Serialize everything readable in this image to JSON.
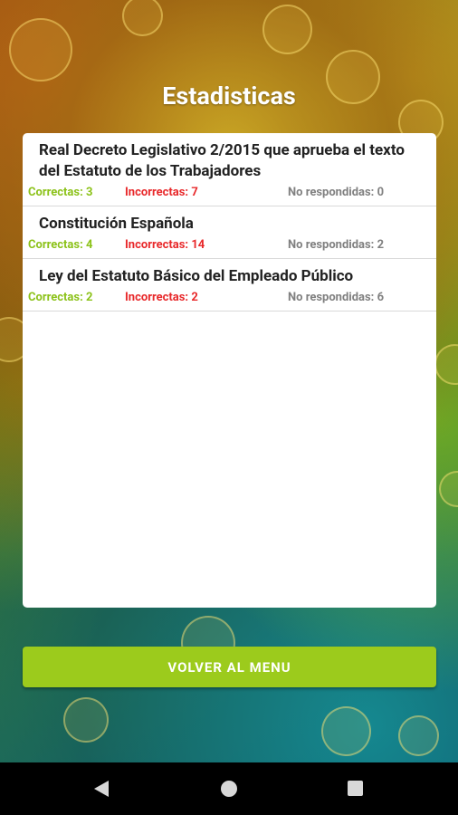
{
  "header": {
    "title": "Estadisticas"
  },
  "laws": [
    {
      "title": "Real Decreto Legislativo 2/2015 que aprueba el texto del Estatuto de los Trabajadores",
      "correct": "Correctas: 3",
      "incorrect": "Incorrectas: 7",
      "unanswered": "No respondidas: 0"
    },
    {
      "title": "Constitución Española",
      "correct": "Correctas: 4",
      "incorrect": "Incorrectas: 14",
      "unanswered": "No respondidas: 2"
    },
    {
      "title": "Ley del Estatuto Básico del Empleado Público",
      "correct": "Correctas: 2",
      "incorrect": "Incorrectas: 2",
      "unanswered": "No respondidas: 6"
    }
  ],
  "actions": {
    "back_label": "VOLVER AL MENU"
  },
  "navbar": {
    "icons": [
      "back-icon",
      "home-icon",
      "recent-apps-icon"
    ]
  },
  "colors": {
    "correct": "#8cc21a",
    "incorrect": "#e8292b",
    "unanswered": "#808080",
    "button": "#9ccb1c"
  }
}
